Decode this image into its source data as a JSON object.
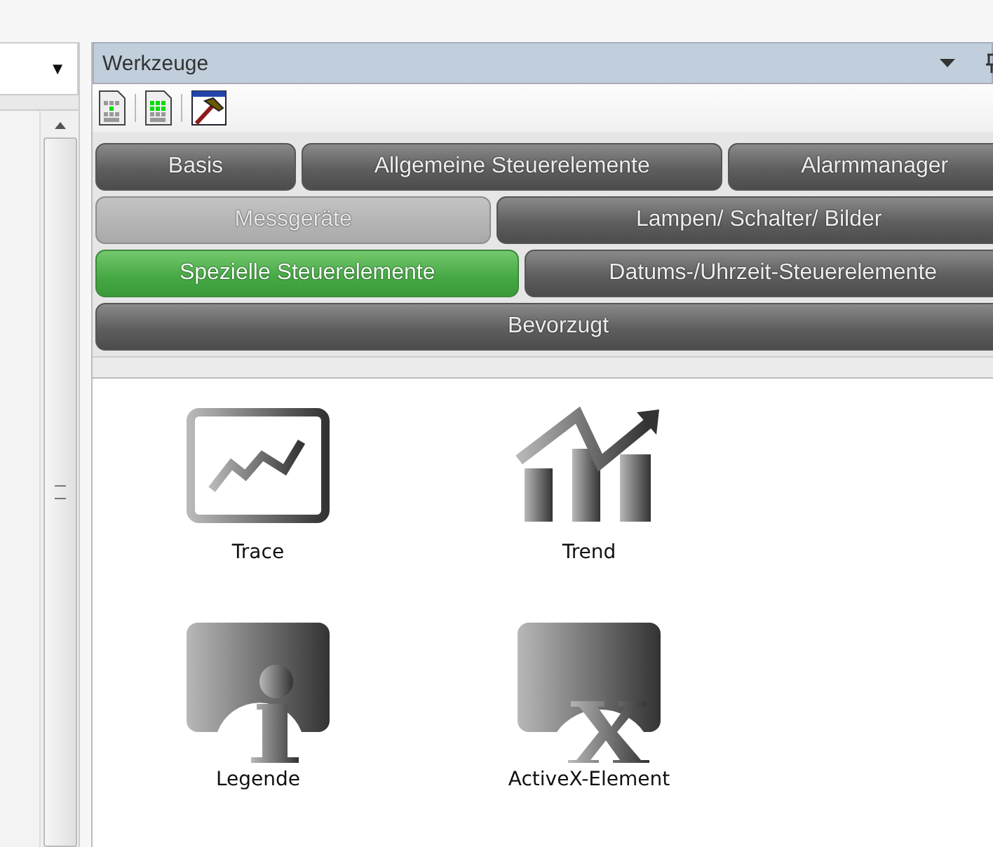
{
  "left_panel": {
    "caret": "▼"
  },
  "tool_window": {
    "title": "Werkzeuge"
  },
  "tab_rows": [
    [
      {
        "label": "Basis",
        "selected": false,
        "disabled": false
      },
      {
        "label": "Allgemeine Steuerelemente",
        "selected": false,
        "disabled": false
      },
      {
        "label": "Alarmmanager",
        "selected": false,
        "disabled": false
      }
    ],
    [
      {
        "label": "Messgeräte",
        "selected": false,
        "disabled": true
      },
      {
        "label": "Lampen/ Schalter/ Bilder",
        "selected": false,
        "disabled": false
      }
    ],
    [
      {
        "label": "Spezielle Steuerelemente",
        "selected": true,
        "disabled": false
      },
      {
        "label": "Datums-/Uhrzeit-Steuerelemente",
        "selected": false,
        "disabled": false
      }
    ],
    [
      {
        "label": "Bevorzugt",
        "selected": false,
        "disabled": false
      }
    ]
  ],
  "items": [
    {
      "label": "Trace",
      "kind": "trace"
    },
    {
      "label": "Trend",
      "kind": "trend"
    },
    {
      "label": "Legende",
      "kind": "legend"
    },
    {
      "label": "ActiveX-Element",
      "kind": "activex"
    }
  ]
}
